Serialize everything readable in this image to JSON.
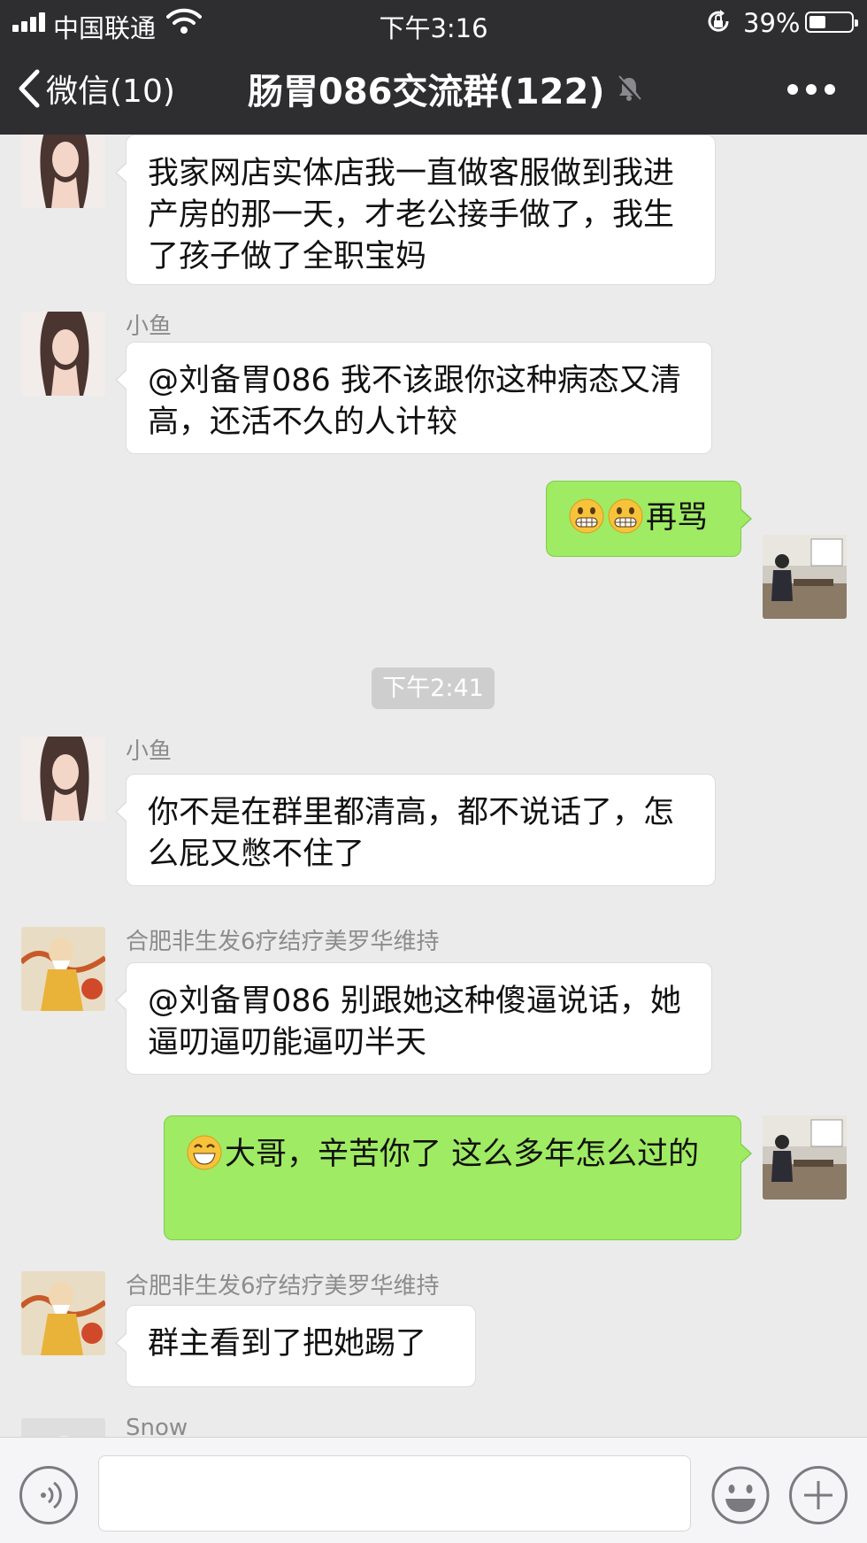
{
  "status_bar": {
    "carrier": "中国联通",
    "time": "下午3:16",
    "battery": "39%",
    "battery_level": 0.39
  },
  "nav": {
    "back_label": "微信(10)",
    "title": "肠胃086交流群(122)"
  },
  "messages": [
    {
      "side": "left",
      "sender": "小鱼",
      "text": "我家网店实体店我一直做客服做到我进产房的那一天，才老公接手做了，我生了孩子做了全职宝妈"
    },
    {
      "side": "left",
      "sender": "小鱼",
      "text": "@刘备胃086 我不该跟你这种病态又清高，还活不久的人计较"
    },
    {
      "side": "right",
      "emojis": [
        "grimace",
        "grimace"
      ],
      "text": "再骂"
    },
    {
      "side": "left",
      "sender": "小鱼",
      "text": "你不是在群里都清高，都不说话了，怎么屁又憋不住了"
    },
    {
      "side": "left",
      "sender": "合肥非生发6疗结疗美罗华维持",
      "text": "@刘备胃086 别跟她这种傻逼说话，她逼叨逼叨能逼叨半天"
    },
    {
      "side": "right",
      "emojis": [
        "grin"
      ],
      "text": "大哥，辛苦你了 这么多年怎么过的"
    },
    {
      "side": "left",
      "sender": "合肥非生发6疗结疗美罗华维持",
      "text": "群主看到了把她踢了"
    },
    {
      "side": "left",
      "sender": "Snow",
      "text": ""
    }
  ],
  "timestamp": "下午2:41",
  "input": {
    "placeholder": "",
    "value": ""
  },
  "colors": {
    "nav_bg": "#2e2e30",
    "chat_bg": "#ebebeb",
    "my_bubble": "#9feb63",
    "their_bubble": "#ffffff"
  }
}
